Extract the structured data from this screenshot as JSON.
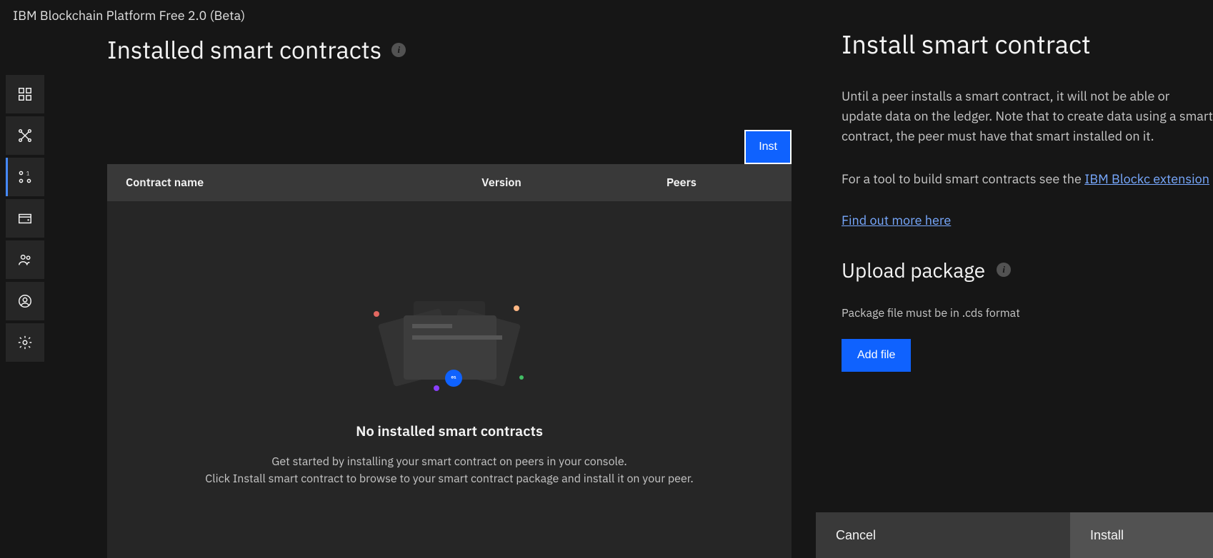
{
  "app": {
    "title": "IBM Blockchain Platform Free 2.0 (Beta)"
  },
  "sidebar": {
    "items": [
      {
        "name": "dashboard"
      },
      {
        "name": "nodes"
      },
      {
        "name": "smart-contracts"
      },
      {
        "name": "wallet"
      },
      {
        "name": "organizations"
      },
      {
        "name": "user"
      },
      {
        "name": "settings"
      }
    ],
    "active_index": 2
  },
  "main": {
    "title": "Installed smart contracts",
    "install_button_label": "Inst",
    "table": {
      "headers": [
        "Contract name",
        "Version",
        "Peers"
      ]
    },
    "empty_state": {
      "title": "No installed smart contracts",
      "line1": "Get started by installing your smart contract on peers in your console.",
      "line2": "Click Install smart contract to browse to your smart contract package and install it on your peer."
    }
  },
  "panel": {
    "title": "Install smart contract",
    "description": "Until a peer installs a smart contract, it will not be able or update data on the ledger. Note that to create data using a smart contract, the peer must have that smart installed on it.",
    "tool_prefix": "For a tool to build smart contracts see the ",
    "tool_link_text": "IBM Blockc extension",
    "more_link_text": "Find out more here",
    "upload_section_title": "Upload package",
    "upload_hint": "Package file must be in .cds format",
    "add_file_label": "Add file",
    "footer": {
      "cancel": "Cancel",
      "install": "Install"
    }
  }
}
